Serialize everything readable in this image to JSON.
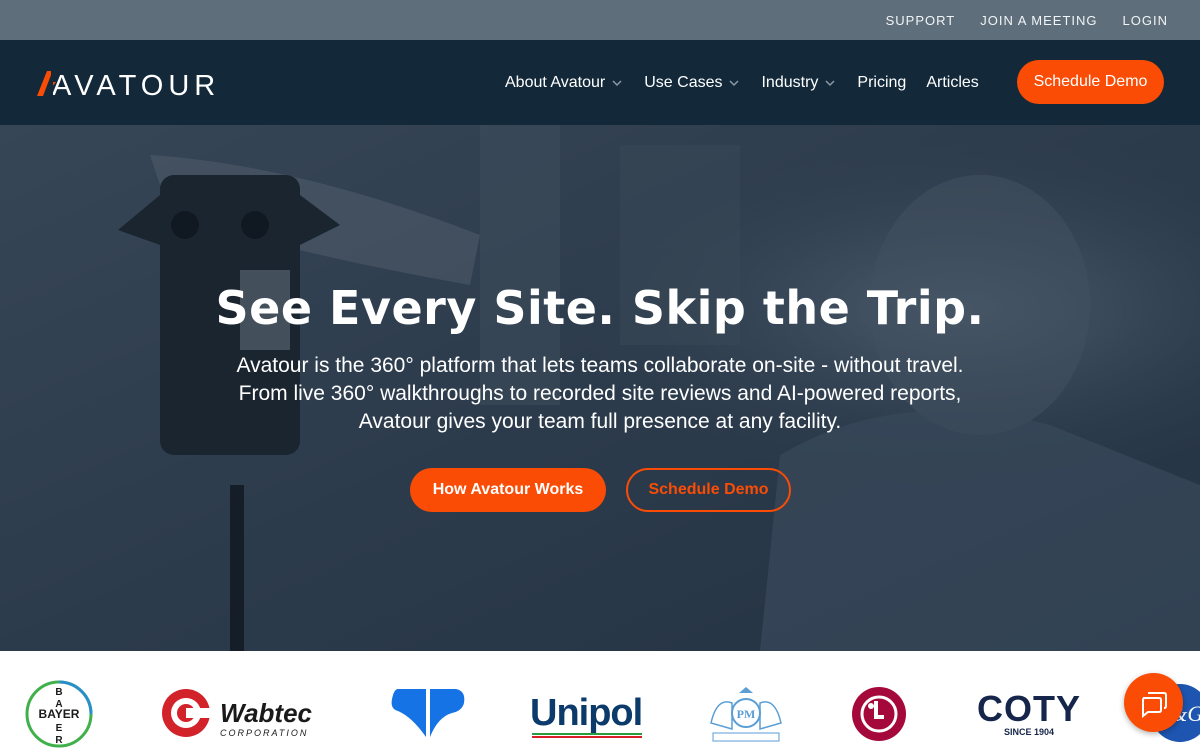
{
  "utility": {
    "links": [
      "SUPPORT",
      "JOIN A MEETING",
      "LOGIN"
    ]
  },
  "brand": {
    "name": "AVATOUR",
    "accent": "#fa4c05",
    "nav_bg": "#13293a"
  },
  "nav": {
    "items": [
      {
        "label": "About Avatour",
        "has_dropdown": true
      },
      {
        "label": "Use Cases",
        "has_dropdown": true
      },
      {
        "label": "Industry",
        "has_dropdown": true
      },
      {
        "label": "Pricing",
        "has_dropdown": false
      },
      {
        "label": "Articles",
        "has_dropdown": false
      }
    ],
    "cta": "Schedule Demo"
  },
  "hero": {
    "title": "See Every Site. Skip the Trip.",
    "subtitle_lines": [
      "Avatour is the 360° platform that lets teams collaborate on-site - without travel.",
      "From live 360° walkthroughs to recorded site reviews and AI-powered reports,",
      "Avatour gives your team full presence at any facility."
    ],
    "primary_button": "How Avatour Works",
    "secondary_button": "Schedule Demo"
  },
  "clients": {
    "bayer": "BAYER",
    "wabtec": "Wabtec",
    "wabtec_sub": "CORPORATION",
    "unipol": "Unipol",
    "pm": "PM",
    "lg": "LG",
    "coty": "COTY",
    "coty_sub": "SINCE 1904",
    "pg": "P&G"
  }
}
